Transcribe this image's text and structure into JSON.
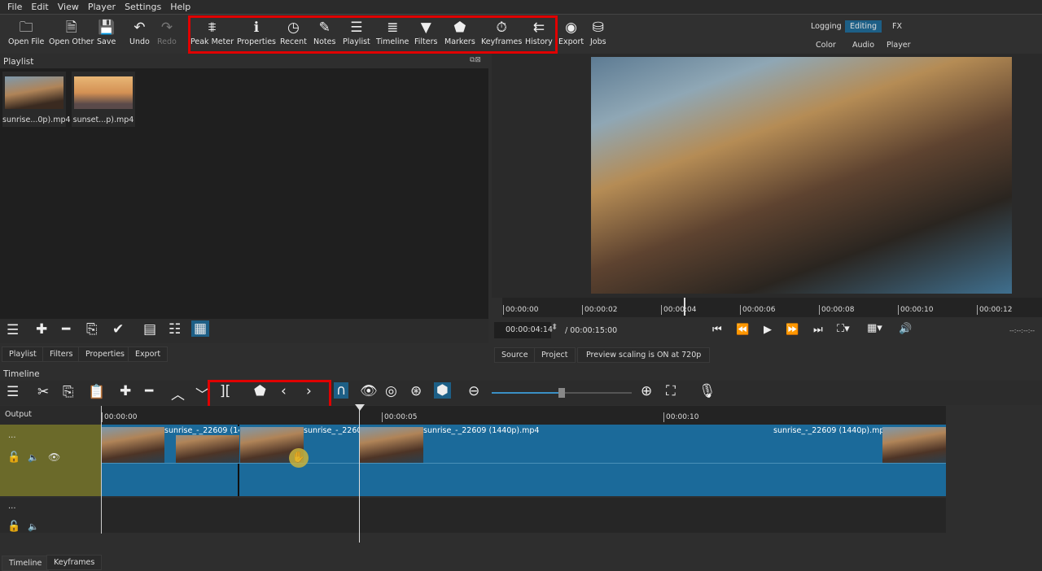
{
  "menu": [
    "File",
    "Edit",
    "View",
    "Player",
    "Settings",
    "Help"
  ],
  "toolbar": {
    "open_file": "Open File",
    "open_other": "Open Other",
    "save": "Save",
    "undo": "Undo",
    "redo": "Redo",
    "peak_meter": "Peak Meter",
    "properties": "Properties",
    "recent": "Recent",
    "notes": "Notes",
    "playlist": "Playlist",
    "timeline": "Timeline",
    "filters": "Filters",
    "markers": "Markers",
    "keyframes": "Keyframes",
    "history": "History",
    "export": "Export",
    "jobs": "Jobs"
  },
  "layouts": {
    "logging": "Logging",
    "editing": "Editing",
    "fx": "FX",
    "color": "Color",
    "audio": "Audio",
    "player": "Player"
  },
  "playlist": {
    "title": "Playlist",
    "items": [
      {
        "name": "sunrise...0p).mp4"
      },
      {
        "name": "sunset...p).mp4"
      }
    ],
    "tabs": [
      "Playlist",
      "Filters",
      "Properties",
      "Export"
    ]
  },
  "player": {
    "ruler": [
      "00:00:00",
      "00:00:02",
      "00:00:04",
      "00:00:06",
      "00:00:08",
      "00:00:10",
      "00:00:12"
    ],
    "position": "00:00:04:14",
    "duration": "/ 00:00:15:00",
    "timecode_right": "--:--:--:--",
    "tabs": [
      "Source",
      "Project"
    ],
    "scaling": "Preview scaling is ON at 720p"
  },
  "timeline": {
    "title": "Timeline",
    "output": "Output",
    "ruler": [
      "00:00:00",
      "00:00:05",
      "00:00:10"
    ],
    "track_menu": "...",
    "clips": [
      "sunrise_-_22609 (144",
      "sunrise_-_2260",
      "sunrise_-_22609 (1440p).mp4",
      "sunrise_-_22609 (1440p).mp4"
    ],
    "zoom_level": 0.5,
    "bottom_tabs": [
      "Timeline",
      "Keyframes"
    ]
  },
  "colors": {
    "accent": "#1d5f86",
    "clip": "#1b6a9a",
    "track_selected": "#6b6a2a",
    "highlight": "#e00000"
  }
}
